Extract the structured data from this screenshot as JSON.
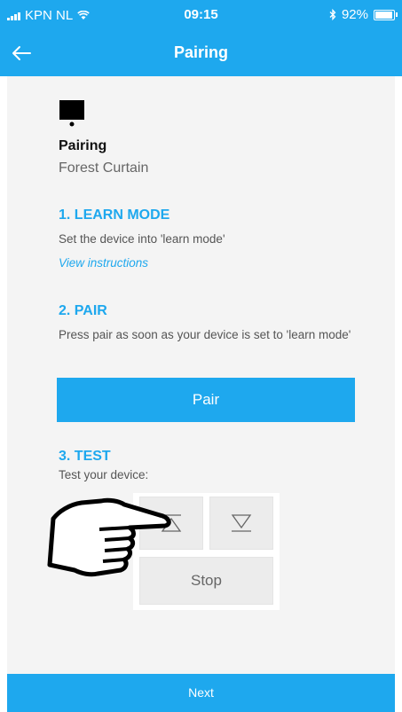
{
  "status_bar": {
    "carrier": "KPN NL",
    "time": "09:15",
    "battery": "92%",
    "battery_level": 0.92
  },
  "header": {
    "title": "Pairing",
    "back_icon": "arrow-left-icon"
  },
  "device": {
    "icon": "screen-device-icon",
    "heading": "Pairing",
    "name": "Forest Curtain"
  },
  "steps": {
    "learn": {
      "title": "1. LEARN MODE",
      "description": "Set the device into 'learn mode'",
      "link": "View instructions"
    },
    "pair": {
      "title": "2. PAIR",
      "description": "Press pair as soon as your device is set to 'learn mode'",
      "button": "Pair"
    },
    "test": {
      "title": "3. TEST",
      "description": "Test your device:",
      "up_icon": "open-up-icon",
      "down_icon": "close-down-icon",
      "stop": "Stop"
    }
  },
  "footer": {
    "next": "Next"
  },
  "colors": {
    "accent": "#1ea8ee",
    "panel": "#f4f4f4"
  }
}
